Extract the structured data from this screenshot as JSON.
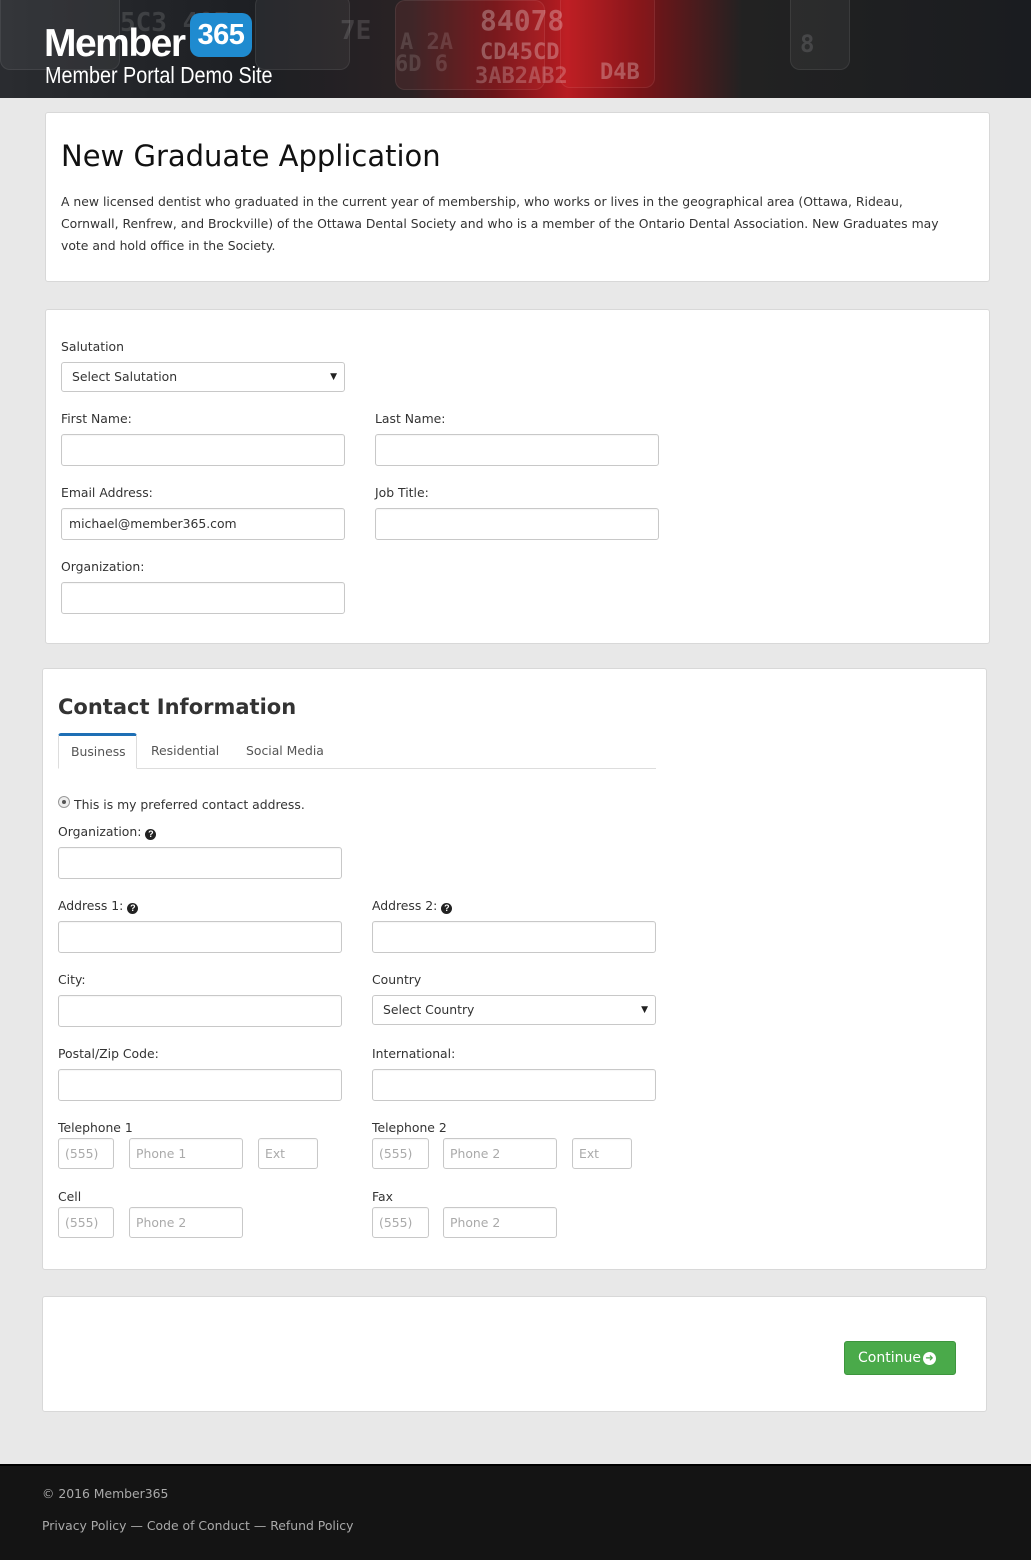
{
  "header": {
    "logo_word": "Member",
    "logo_badge": "365",
    "logo_subtitle": "Member Portal Demo Site"
  },
  "intro": {
    "title": "New Graduate Application",
    "description": "A new licensed dentist who graduated in the current year of membership, who works or lives in the geographical area (Ottawa, Rideau, Cornwall, Renfrew, and Brockville) of the Ottawa Dental Society and who is a member of the Ontario Dental Association. New Graduates may vote and hold office in the Society."
  },
  "personal": {
    "salutation_label": "Salutation",
    "salutation_value": "Select Salutation",
    "first_name_label": "First Name:",
    "first_name_value": "",
    "last_name_label": "Last Name:",
    "last_name_value": "",
    "email_label": "Email Address:",
    "email_value": "michael@member365.com",
    "job_title_label": "Job Title:",
    "job_title_value": "",
    "organization_label": "Organization:",
    "organization_value": ""
  },
  "contact": {
    "title": "Contact Information",
    "tabs": [
      {
        "label": "Business",
        "active": true
      },
      {
        "label": "Residential",
        "active": false
      },
      {
        "label": "Social Media",
        "active": false
      }
    ],
    "preferred_label": "This is my preferred contact address.",
    "organization_label": "Organization:",
    "address1_label": "Address 1:",
    "address2_label": "Address 2:",
    "city_label": "City:",
    "country_label": "Country",
    "country_value": "Select Country",
    "postal_label": "Postal/Zip Code:",
    "international_label": "International:",
    "telephone1_label": "Telephone 1",
    "telephone2_label": "Telephone 2",
    "cell_label": "Cell",
    "fax_label": "Fax",
    "area_placeholder": "(555)",
    "phone1_placeholder": "Phone 1",
    "phone2_placeholder": "Phone 2",
    "ext_placeholder": "Ext"
  },
  "actions": {
    "continue_label": "Continue"
  },
  "footer": {
    "copyright": "© 2016 Member365",
    "links": [
      "Privacy Policy",
      "Code of Conduct",
      "Refund Policy"
    ],
    "separator": "—"
  },
  "colors": {
    "accent_blue": "#1e6fb5",
    "button_green": "#4aaa4a",
    "footer_bg": "#141414"
  }
}
